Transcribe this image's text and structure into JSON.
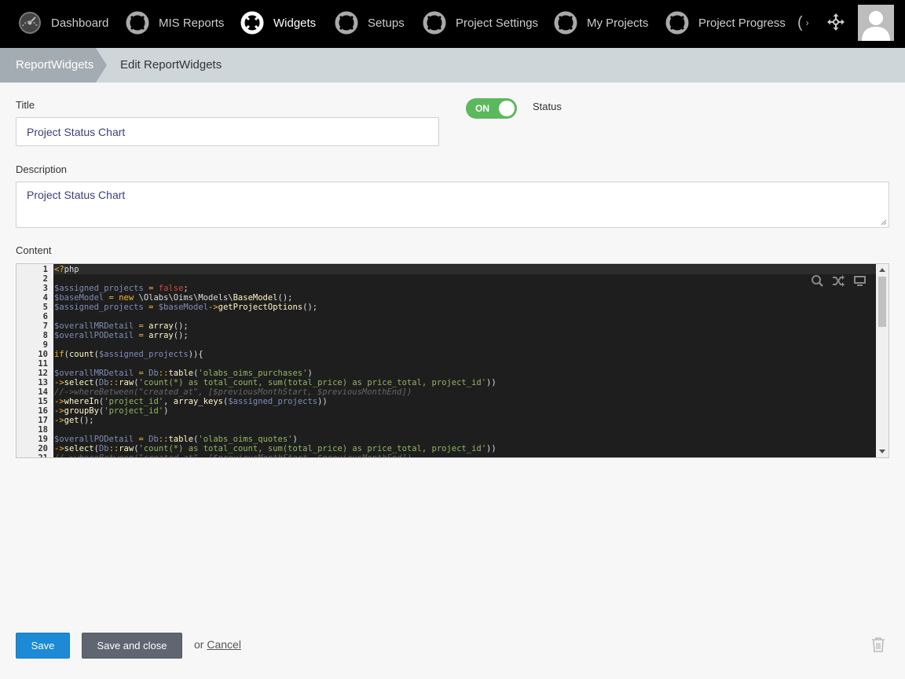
{
  "nav": {
    "items": [
      {
        "label": "Dashboard",
        "icon": "speedometer-icon"
      },
      {
        "label": "MIS Reports",
        "icon": "lifebuoy-icon"
      },
      {
        "label": "Widgets",
        "icon": "lifebuoy-icon",
        "active": true
      },
      {
        "label": "Setups",
        "icon": "lifebuoy-icon"
      },
      {
        "label": "Project Settings",
        "icon": "lifebuoy-icon"
      },
      {
        "label": "My Projects",
        "icon": "lifebuoy-icon"
      },
      {
        "label": "Project Progress",
        "icon": "lifebuoy-icon"
      }
    ],
    "overflow_glyph": "(",
    "overflow_arrow": "›"
  },
  "breadcrumb": {
    "parent": "ReportWidgets",
    "current": "Edit ReportWidgets"
  },
  "form": {
    "title_label": "Title",
    "title_value": "Project Status Chart",
    "status_label": "Status",
    "status_toggle": "ON",
    "description_label": "Description",
    "description_value": "Project Status Chart",
    "content_label": "Content"
  },
  "editor": {
    "lines": [
      {
        "n": "1",
        "t": "<?php"
      },
      {
        "n": "2",
        "t": ""
      },
      {
        "n": "3",
        "t": "$assigned_projects = false;"
      },
      {
        "n": "4",
        "t": "$baseModel = new \\Olabs\\Oims\\Models\\BaseModel();"
      },
      {
        "n": "5",
        "t": "$assigned_projects = $baseModel->getProjectOptions();"
      },
      {
        "n": "6",
        "t": ""
      },
      {
        "n": "7",
        "t": "$overallMRDetail = array();"
      },
      {
        "n": "8",
        "t": "$overallPODetail = array();"
      },
      {
        "n": "9",
        "t": ""
      },
      {
        "n": "10",
        "t": "if(count($assigned_projects)){"
      },
      {
        "n": "11",
        "t": ""
      },
      {
        "n": "12",
        "t": "$overallMRDetail = Db::table('olabs_oims_purchases')"
      },
      {
        "n": "13",
        "t": "->select(Db::raw('count(*) as total_count, sum(total_price) as price_total, project_id'))"
      },
      {
        "n": "14",
        "t": "//->whereBetween(\"created_at\", [$previousMonthStart, $previousMonthEnd])"
      },
      {
        "n": "15",
        "t": "->whereIn('project_id', array_keys($assigned_projects))"
      },
      {
        "n": "16",
        "t": "->groupBy('project_id')"
      },
      {
        "n": "17",
        "t": "->get();"
      },
      {
        "n": "18",
        "t": ""
      },
      {
        "n": "19",
        "t": "$overallPODetail = Db::table('olabs_oims_quotes')"
      },
      {
        "n": "20",
        "t": "->select(Db::raw('count(*) as total_count, sum(total_price) as price_total, project_id'))"
      },
      {
        "n": "21",
        "t": "//->whereBetween(\"created_at\", [$previousMonthStart, $previousMonthEnd])"
      }
    ]
  },
  "actions": {
    "save": "Save",
    "save_close": "Save and close",
    "or": "or",
    "cancel": "Cancel"
  },
  "colors": {
    "nav_bg": "#000000",
    "crumb_bg": "#cfd6da",
    "crumb_active": "#a4acb3",
    "toggle_on": "#5cb85c",
    "save_btn": "#1c8ad4",
    "save_close_btn": "#5f6571"
  }
}
